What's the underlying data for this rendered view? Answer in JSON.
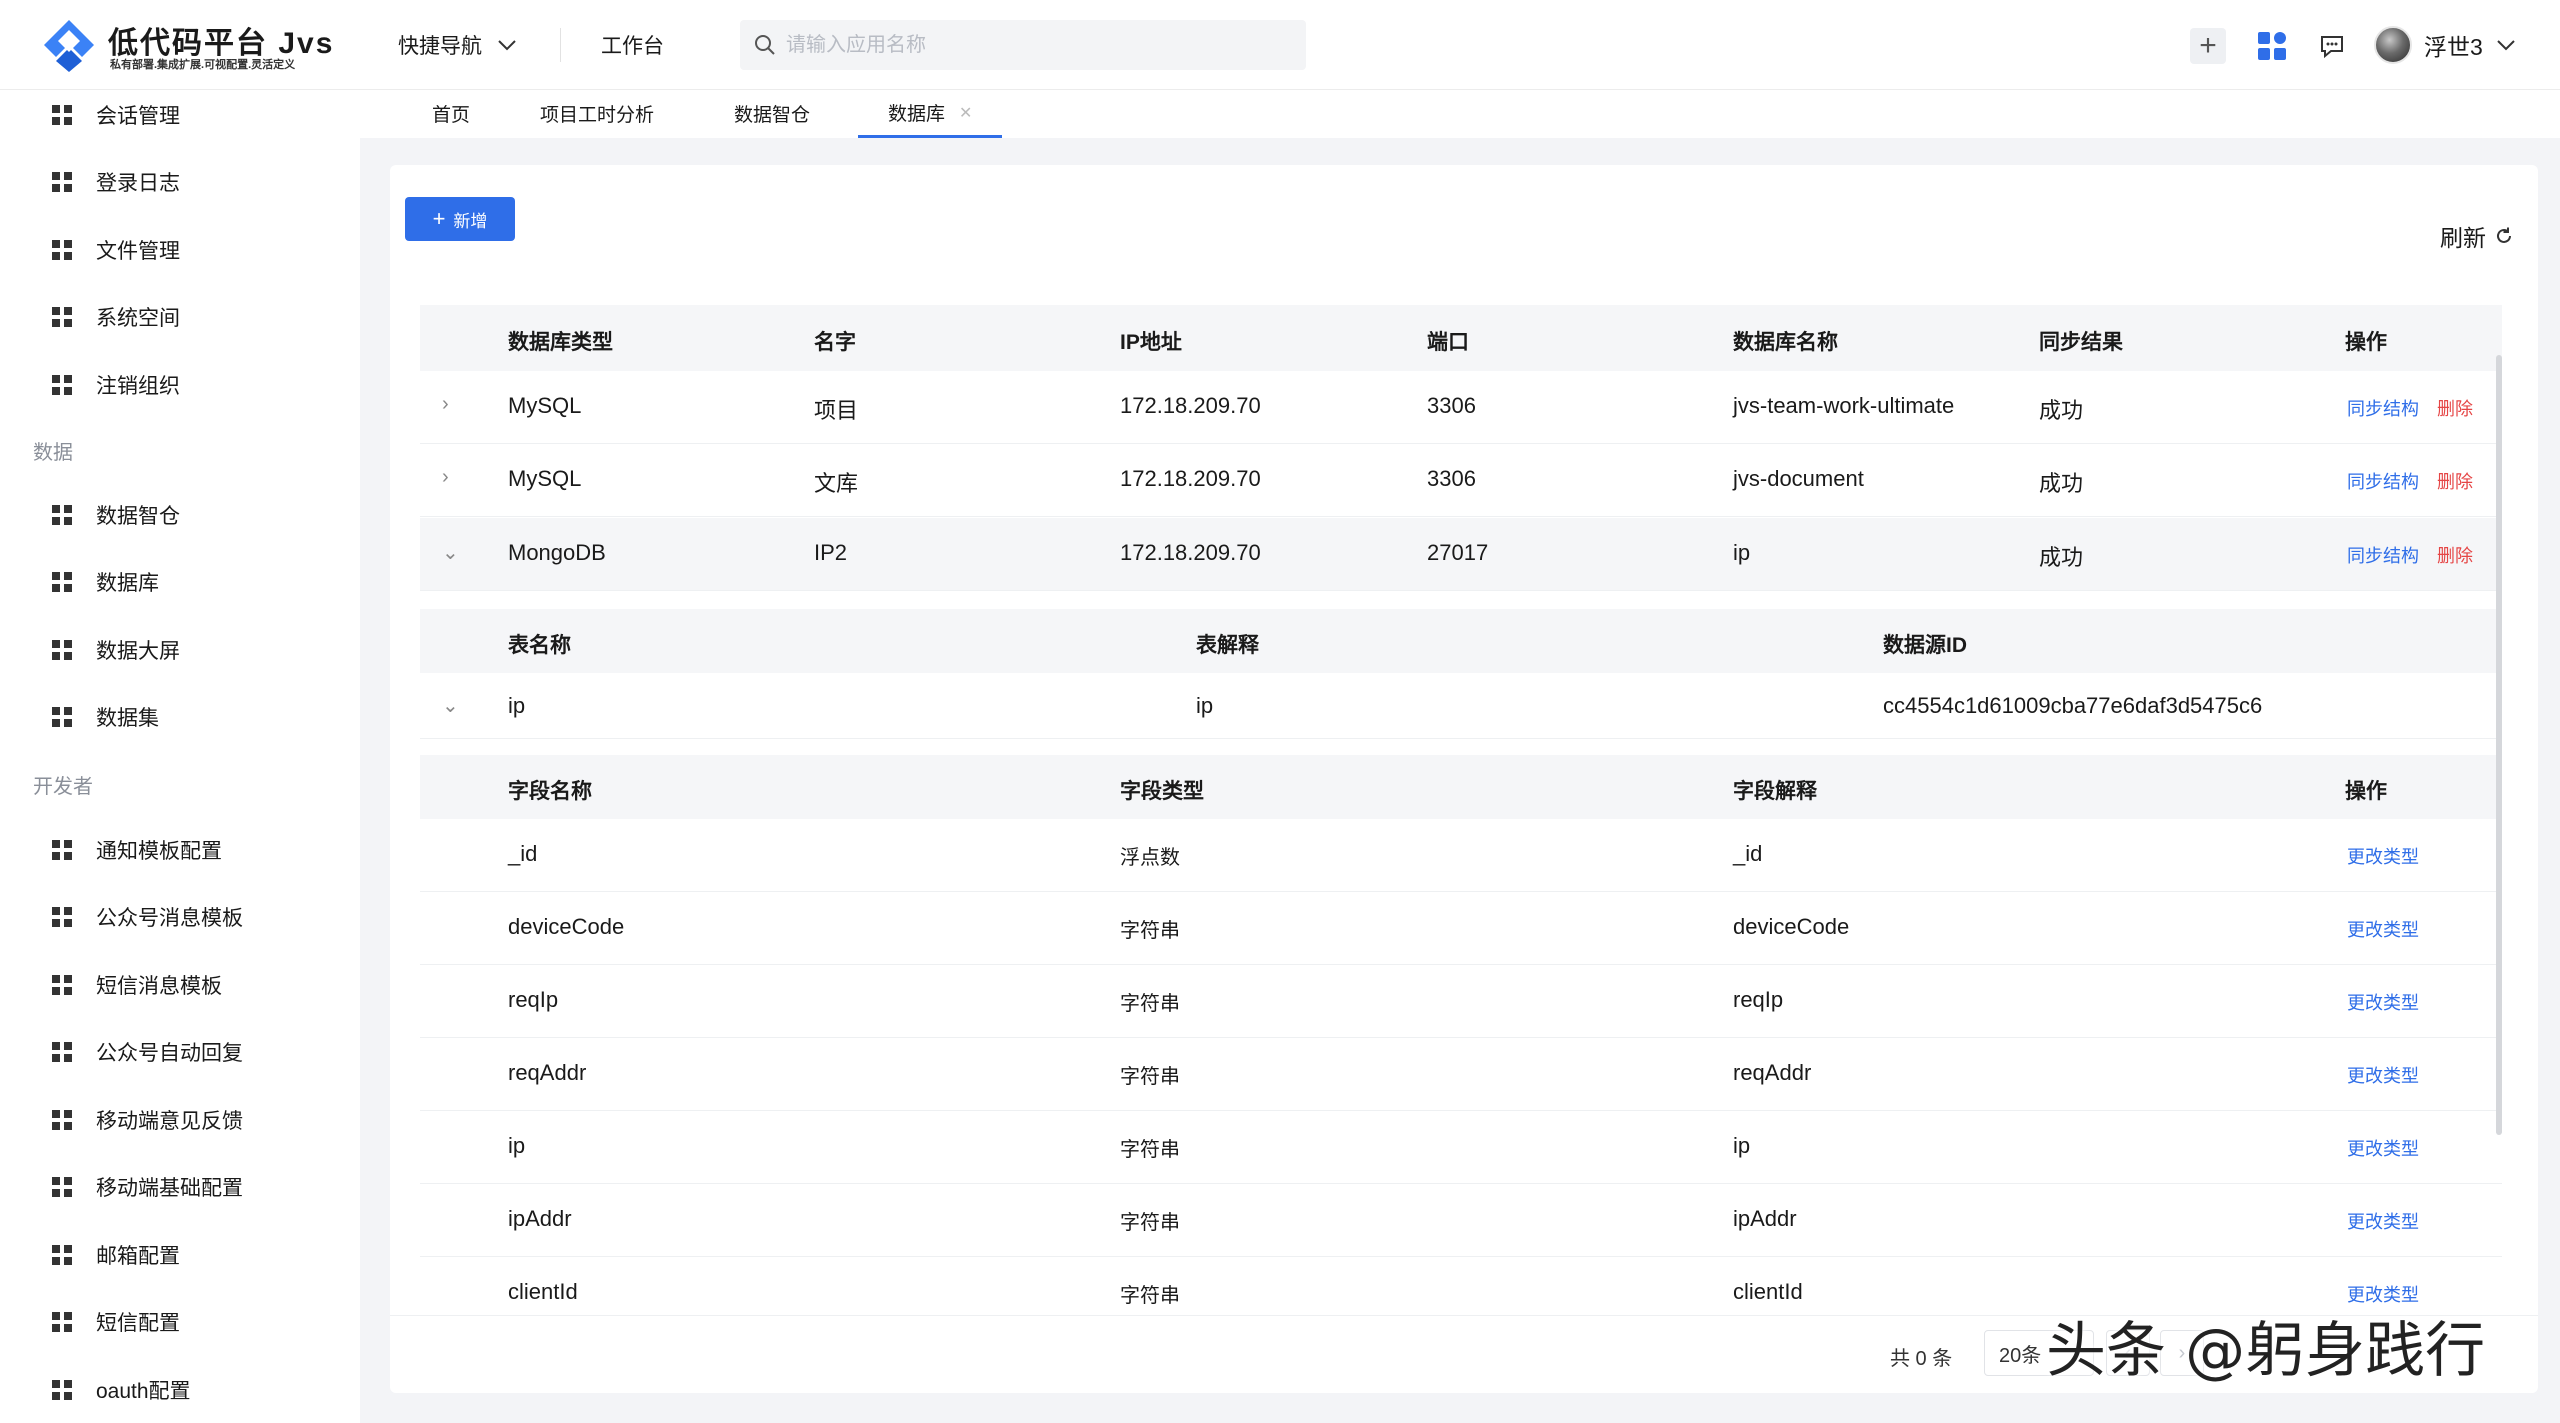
{
  "header": {
    "logo_title": "低代码平台 Jvs",
    "logo_subtitle": "私有部署.集成扩展.可视配置.灵活定义",
    "quick_nav": "快捷导航",
    "workbench": "工作台",
    "search_placeholder": "请输入应用名称",
    "user_name": "浮世3"
  },
  "sidebar": {
    "items_top": [
      "会话管理",
      "登录日志",
      "文件管理",
      "系统空间",
      "注销组织"
    ],
    "group_data": "数据",
    "items_data": [
      "数据智仓",
      "数据库",
      "数据大屏",
      "数据集"
    ],
    "group_dev": "开发者",
    "items_dev": [
      "通知模板配置",
      "公众号消息模板",
      "短信消息模板",
      "公众号自动回复",
      "移动端意见反馈",
      "移动端基础配置",
      "邮箱配置",
      "短信配置",
      "oauth配置"
    ]
  },
  "tabs": [
    "首页",
    "项目工时分析",
    "数据智仓",
    "数据库"
  ],
  "toolbar": {
    "add": "新增",
    "refresh": "刷新"
  },
  "db_table": {
    "headers": [
      "数据库类型",
      "名字",
      "IP地址",
      "端口",
      "数据库名称",
      "同步结果",
      "操作"
    ],
    "rows": [
      [
        "MySQL",
        "项目",
        "172.18.209.70",
        "3306",
        "jvs-team-work-ultimate",
        "成功"
      ],
      [
        "MySQL",
        "文库",
        "172.18.209.70",
        "3306",
        "jvs-document",
        "成功"
      ],
      [
        "MongoDB",
        "IP2",
        "172.18.209.70",
        "27017",
        "ip",
        "成功"
      ]
    ],
    "action_sync": "同步结构",
    "action_delete": "删除"
  },
  "sub_table": {
    "headers": [
      "表名称",
      "表解释",
      "数据源ID"
    ],
    "row": [
      "ip",
      "ip",
      "cc4554c1d61009cba77e6daf3d5475c6"
    ]
  },
  "field_table": {
    "headers": [
      "字段名称",
      "字段类型",
      "字段解释",
      "操作"
    ],
    "rows": [
      [
        "_id",
        "浮点数",
        "_id"
      ],
      [
        "deviceCode",
        "字符串",
        "deviceCode"
      ],
      [
        "reqIp",
        "字符串",
        "reqIp"
      ],
      [
        "reqAddr",
        "字符串",
        "reqAddr"
      ],
      [
        "ip",
        "字符串",
        "ip"
      ],
      [
        "ipAddr",
        "字符串",
        "ipAddr"
      ],
      [
        "clientId",
        "字符串",
        "clientId"
      ]
    ],
    "action": "更改类型"
  },
  "pagination": {
    "total": "共 0 条",
    "page_size": "20条"
  },
  "watermark": "头条 @躬身践行",
  "colors": {
    "primary": "#2f6ee8",
    "danger": "#e54545"
  }
}
